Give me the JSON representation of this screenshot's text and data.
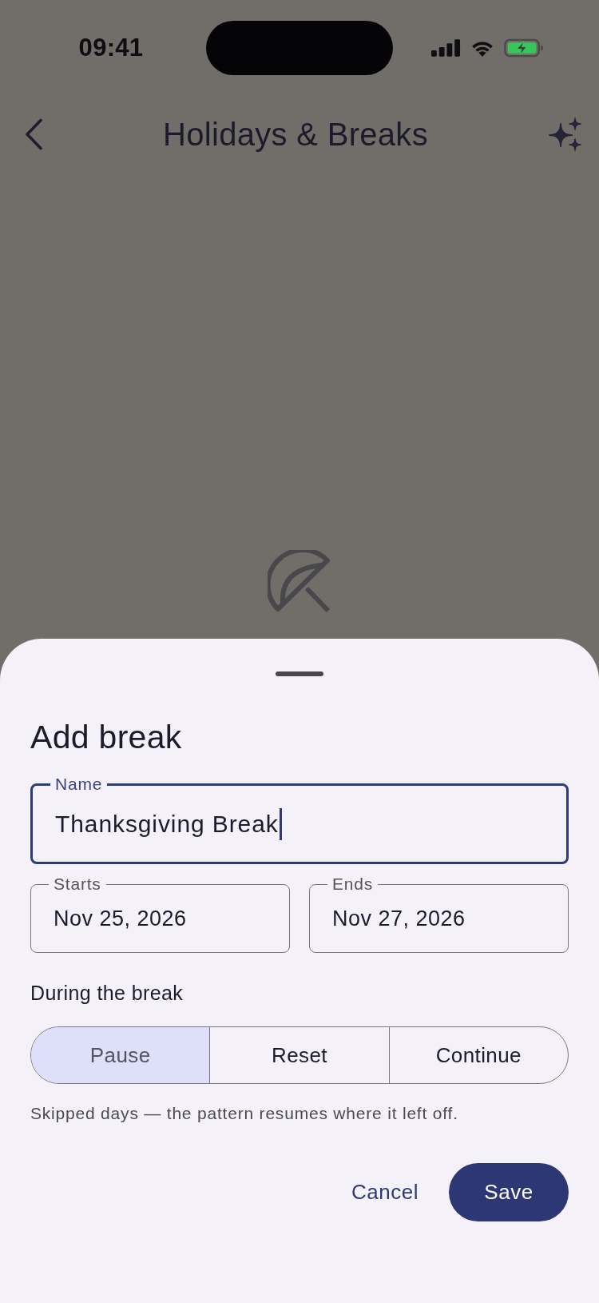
{
  "status_bar": {
    "time": "09:41"
  },
  "header": {
    "title": "Holidays & Breaks"
  },
  "sheet": {
    "title": "Add break",
    "name_field": {
      "label": "Name",
      "value": "Thanksgiving Break",
      "focused": true
    },
    "date_fields": [
      {
        "label": "Starts",
        "value": "Nov 25, 2026",
        "focused": false
      },
      {
        "label": "Ends",
        "value": "Nov 27, 2026",
        "focused": false
      }
    ],
    "mode": {
      "label": "During the break",
      "options": [
        {
          "label": "Pause",
          "selected": true
        },
        {
          "label": "Reset",
          "selected": false
        },
        {
          "label": "Continue",
          "selected": false
        }
      ]
    },
    "hint": "Skipped days — the pattern resumes where it left off.",
    "buttons": [
      {
        "label": "Cancel",
        "kind": "text"
      },
      {
        "label": "Save",
        "kind": "filled"
      }
    ]
  }
}
